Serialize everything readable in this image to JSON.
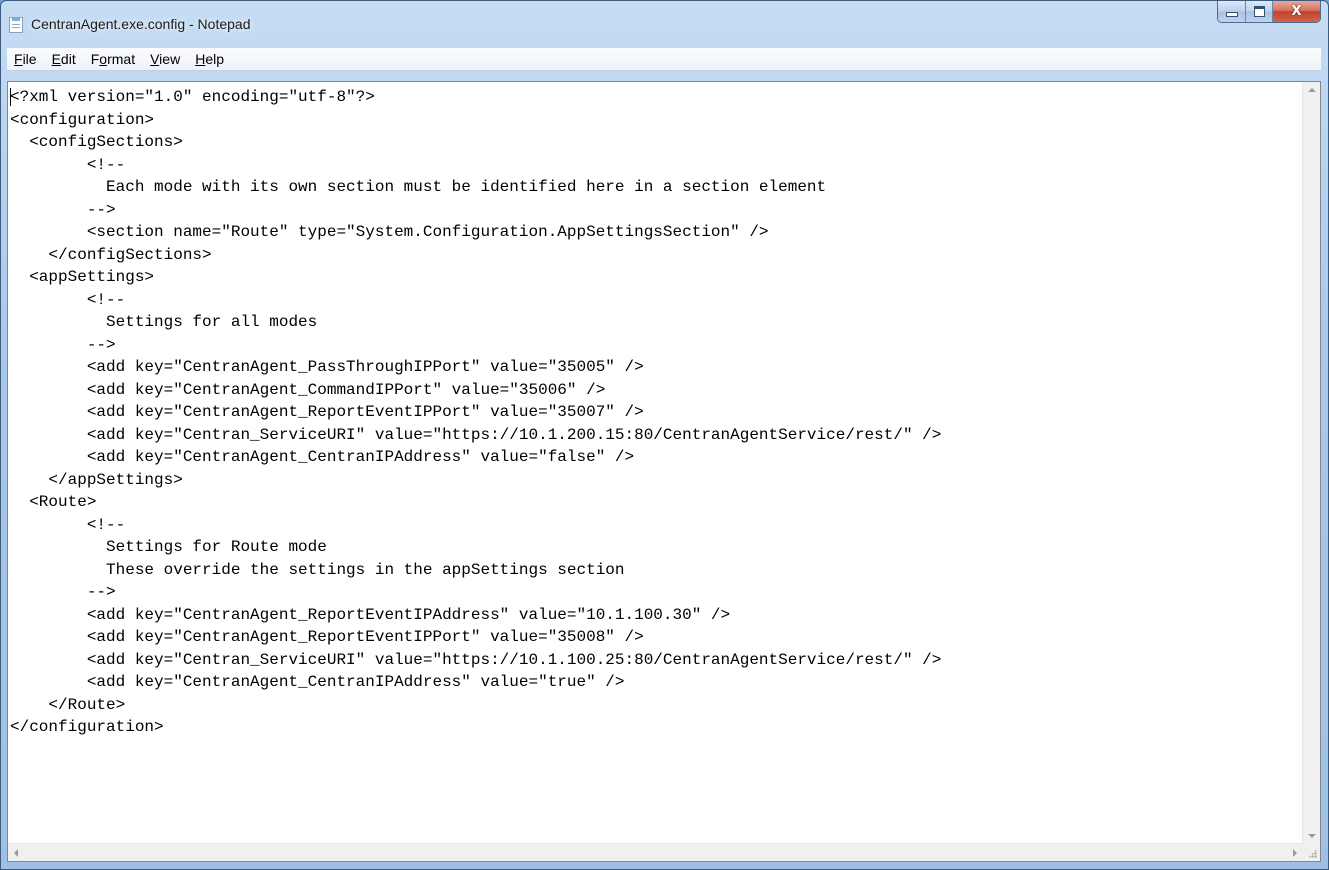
{
  "window": {
    "title": "CentranAgent.exe.config - Notepad",
    "app_icon": "notepad-icon",
    "caption_buttons": {
      "minimize": "minimize-icon",
      "maximize": "maximize-icon",
      "close": "close-icon",
      "close_glyph": "X"
    }
  },
  "menu": {
    "items": [
      {
        "accel": "F",
        "rest": "ile"
      },
      {
        "accel": "E",
        "rest": "dit"
      },
      {
        "pre": "F",
        "accel": "o",
        "rest": "rmat"
      },
      {
        "accel": "V",
        "rest": "iew"
      },
      {
        "accel": "H",
        "rest": "elp"
      }
    ]
  },
  "editor": {
    "content": "<?xml version=\"1.0\" encoding=\"utf-8\"?>\n<configuration>\n  <configSections>\n        <!--\n          Each mode with its own section must be identified here in a section element\n        -->\n        <section name=\"Route\" type=\"System.Configuration.AppSettingsSection\" />\n    </configSections>\n  <appSettings>\n        <!--\n          Settings for all modes\n        -->\n        <add key=\"CentranAgent_PassThroughIPPort\" value=\"35005\" />\n        <add key=\"CentranAgent_CommandIPPort\" value=\"35006\" />\n        <add key=\"CentranAgent_ReportEventIPPort\" value=\"35007\" />\n        <add key=\"Centran_ServiceURI\" value=\"https://10.1.200.15:80/CentranAgentService/rest/\" />\n        <add key=\"CentranAgent_CentranIPAddress\" value=\"false\" />\n    </appSettings>\n  <Route>\n        <!--\n          Settings for Route mode\n          These override the settings in the appSettings section\n        -->\n        <add key=\"CentranAgent_ReportEventIPAddress\" value=\"10.1.100.30\" />\n        <add key=\"CentranAgent_ReportEventIPPort\" value=\"35008\" />\n        <add key=\"Centran_ServiceURI\" value=\"https://10.1.100.25:80/CentranAgentService/rest/\" />\n        <add key=\"CentranAgent_CentranIPAddress\" value=\"true\" />\n    </Route>\n</configuration>"
  },
  "colors": {
    "window_frame": "#a9c8ea",
    "close_button": "#c2442b",
    "text": "#000000",
    "background": "#ffffff"
  }
}
